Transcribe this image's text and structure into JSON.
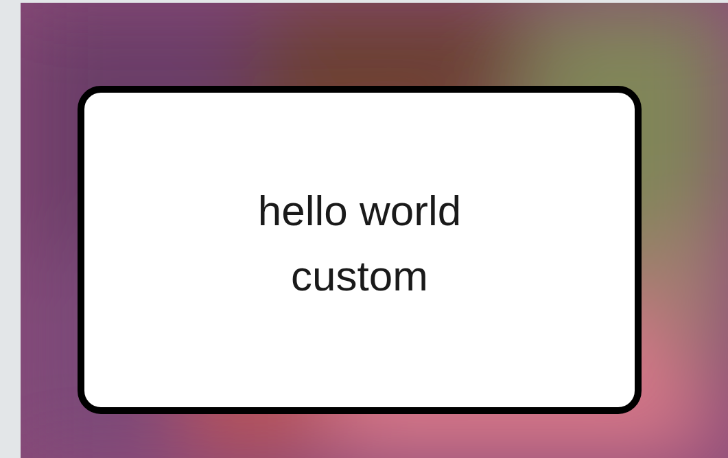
{
  "message_box": {
    "lines": [
      "hello world",
      "custom"
    ]
  }
}
